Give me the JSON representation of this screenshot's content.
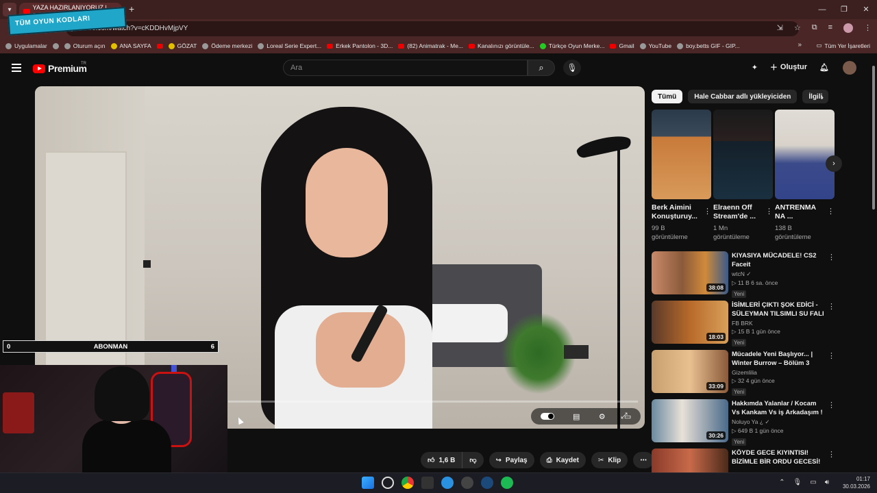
{
  "browser": {
    "tab_title": "YAZA HAZIRLANIYORUZ | g",
    "sticker_text": "TÜM OYUN KODLARI",
    "url": "youtube.com/watch?v=cKDDHvMjpVY",
    "bookmarks": [
      "Uygulamalar",
      "Oturum açın",
      "ANA SAYFA",
      "GÖZAT",
      "Ödeme merkezi",
      "Loreal Serie Expert...",
      "Erkek Pantolon - 3D...",
      "(82) Animatrak - Me...",
      "Kanalınızı görüntüle...",
      "Türkçe Oyun Merke...",
      "Gmail",
      "YouTube",
      "boy.betts GIF - GIP..."
    ],
    "all_bookmarks": "Tüm Yer İşaretleri"
  },
  "youtube": {
    "logo_text": "Premium",
    "logo_country": "TR",
    "search_placeholder": "Ara",
    "create_label": "Oluştur"
  },
  "overlay": {
    "sub_left": "0",
    "sub_label": "ABONMAN",
    "sub_right": "6"
  },
  "actions": {
    "likes": "1,6 B",
    "share": "Paylaş",
    "save": "Kaydet",
    "clip": "Klip"
  },
  "chips": [
    "Tümü",
    "Hale Cabbar adlı yükleyiciden",
    "İlgili"
  ],
  "shorts": [
    {
      "title_line1": "Berk Aimini",
      "title_line2": "Konuşturuy...",
      "views_line1": "99 B",
      "views_line2": "görüntüleme"
    },
    {
      "title_line1": "Elraenn Off",
      "title_line2": "Stream'de ...",
      "views_line1": "1 Mn",
      "views_line2": "görüntüleme"
    },
    {
      "title_line1": "ANTRENMA",
      "title_line2": "NA ...",
      "views_line1": "138 B",
      "views_line2": "görüntüleme"
    }
  ],
  "videos": [
    {
      "title": "KIYASIYA MÜCADELE! CS2 Faceit",
      "channel": "wtcN ✓",
      "meta": "▷ 11 B  6 sa. önce",
      "badge": "Yeni",
      "duration": "38:08"
    },
    {
      "title": "İSİMLERİ ÇIKTI ŞOK EDİCİ - SÜLEYMAN TILSIMLI SU FALI",
      "channel": "FB BRK",
      "meta": "▷ 15 B  1 gün önce",
      "badge": "Yeni",
      "duration": "18:03"
    },
    {
      "title": "Mücadele Yeni Başlıyor... | Winter Burrow – Bölüm 3",
      "channel": "Gizemlilia",
      "meta": "▷ 32  4 gün önce",
      "badge": "Yeni",
      "duration": "33:09"
    },
    {
      "title": "Hakkımda Yalanlar / Kocam Vs Kankam Vs iş Arkadaşım !",
      "channel": "Noluyo Ya ¿ ✓",
      "meta": "▷ 649 B  1 gün önce",
      "badge": "Yeni",
      "duration": "30:26"
    },
    {
      "title": "KÖYDE GECE KIYINTISI! BİZİMLE BİR ORDU GECESİ!",
      "channel": "",
      "meta": "",
      "badge": "",
      "duration": ""
    }
  ],
  "taskbar": {
    "time": "01:17",
    "date": "30.03.2026"
  },
  "colors": {
    "youtube_red": "#ff0000",
    "browser_frame": "#4a2626",
    "background": "#0f0f0f"
  },
  "player": {
    "progress_fraction": 0.0
  }
}
